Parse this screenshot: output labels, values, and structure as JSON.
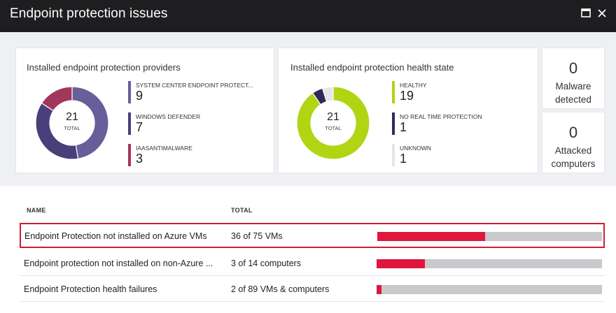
{
  "window": {
    "title": "Endpoint protection issues",
    "maximize_icon": "maximize-icon",
    "close_icon": "close-icon"
  },
  "providers": {
    "title": "Installed endpoint protection providers",
    "center_value": "21",
    "center_label": "TOTAL",
    "items": [
      {
        "label": "SYSTEM CENTER ENDPOINT PROTECT...",
        "value": "9",
        "color": "#675f9a"
      },
      {
        "label": "WINDOWS DEFENDER",
        "value": "7",
        "color": "#4a3f7a"
      },
      {
        "label": "IAASANTIMALWARE",
        "value": "3",
        "color": "#a3365d"
      }
    ]
  },
  "health": {
    "title": "Installed endpoint protection health state",
    "center_value": "21",
    "center_label": "TOTAL",
    "items": [
      {
        "label": "HEALTHY",
        "value": "19",
        "color": "#b1d513"
      },
      {
        "label": "NO REAL TIME PROTECTION",
        "value": "1",
        "color": "#2f2b56"
      },
      {
        "label": "UNKNOWN",
        "value": "1",
        "color": "#e6e6e6"
      }
    ]
  },
  "stats": {
    "malware": {
      "value": "0",
      "label_line1": "Malware",
      "label_line2": "detected"
    },
    "attacked": {
      "value": "0",
      "label_line1": "Attacked",
      "label_line2": "computers"
    }
  },
  "table": {
    "col_name": "NAME",
    "col_total": "TOTAL",
    "rows": [
      {
        "name": "Endpoint Protection not installed on Azure VMs",
        "total": "36 of 75 VMs",
        "fraction": 0.48,
        "highlighted": true
      },
      {
        "name": "Endpoint protection not installed on non-Azure ...",
        "total": "3 of 14 computers",
        "fraction": 0.214,
        "highlighted": false
      },
      {
        "name": "Endpoint Protection health failures",
        "total": "2 of 89 VMs & computers",
        "fraction": 0.022,
        "highlighted": false
      }
    ]
  },
  "colors": {
    "bar_fill": "#e0173c",
    "bar_track": "#c7c9cc",
    "highlight_border": "#cc1f33"
  }
}
